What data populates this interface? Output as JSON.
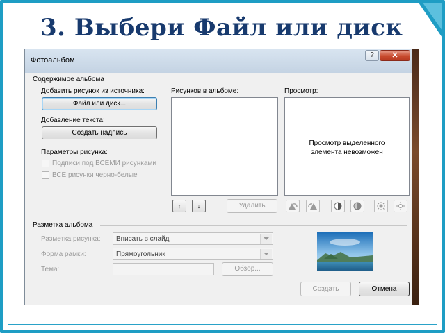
{
  "slide": {
    "title": "3. Выбери Файл или диск"
  },
  "dialog": {
    "title": "Фотоальбом",
    "help_icon": "?",
    "close_icon": "✕",
    "album_content": {
      "group_label": "Содержимое альбома",
      "insert_from_label": "Добавить рисунок из источника:",
      "file_or_disk_button": "Файл или диск...",
      "add_text_label": "Добавление текста:",
      "new_text_box_button": "Создать надпись",
      "picture_options_label": "Параметры рисунка:",
      "captions_below_all": "Подписи под ВСЕМИ рисунками",
      "all_black_and_white": "ВСЕ рисунки черно-белые",
      "pictures_in_album_label": "Рисунков в альбоме:",
      "preview_label": "Просмотр:",
      "preview_unavailable_line1": "Просмотр выделенного",
      "preview_unavailable_line2": "элемента невозможен",
      "move_up_icon": "↑",
      "move_down_icon": "↓",
      "remove_button": "Удалить"
    },
    "album_layout": {
      "group_label": "Разметка альбома",
      "picture_layout_label": "Разметка рисунка:",
      "picture_layout_value": "Вписать в слайд",
      "frame_shape_label": "Форма рамки:",
      "frame_shape_value": "Прямоугольник",
      "theme_label": "Тема:",
      "browse_button": "Обзор..."
    },
    "create_button": "Создать",
    "cancel_button": "Отмена"
  },
  "colors": {
    "frame": "#1e9dc4",
    "title": "#183a6e",
    "dialog_bg": "#f0f0f0",
    "close_button": "#c84a2e"
  }
}
